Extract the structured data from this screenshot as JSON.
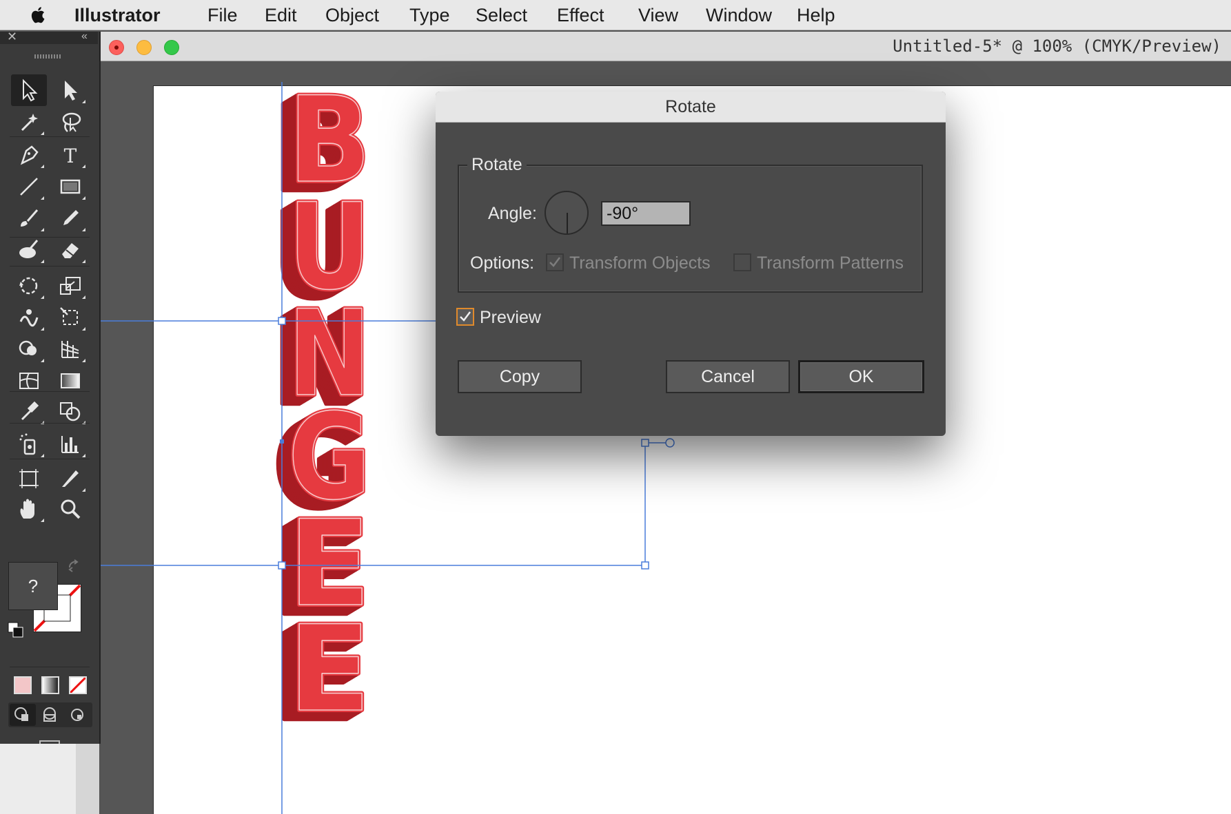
{
  "menubar": {
    "items": [
      "Illustrator",
      "File",
      "Edit",
      "Object",
      "Type",
      "Select",
      "Effect",
      "View",
      "Window",
      "Help"
    ]
  },
  "document": {
    "title": "Untitled-5* @ 100% (CMYK/Preview)"
  },
  "artwork": {
    "letters": [
      "B",
      "U",
      "N",
      "G",
      "E",
      "E"
    ],
    "colors": {
      "face": "#e63a40",
      "extrude": "#a81c23",
      "inline": "#f7c9cb",
      "selection": "#4a7ddb"
    }
  },
  "tools_panel": {
    "fill_unknown_label": "?",
    "tools": [
      "selection-tool",
      "direct-selection-tool",
      "magic-wand-tool",
      "lasso-tool",
      "pen-tool",
      "type-tool",
      "line-tool",
      "rectangle-tool",
      "paintbrush-tool",
      "pencil-tool",
      "blob-brush-tool",
      "eraser-tool",
      "rotate-tool",
      "scale-tool",
      "warp-tool",
      "free-transform-tool",
      "shape-builder-tool",
      "perspective-grid-tool",
      "mesh-tool",
      "gradient-tool",
      "eyedropper-tool",
      "blend-tool",
      "symbol-sprayer-tool",
      "column-graph-tool",
      "artboard-tool",
      "slice-tool",
      "hand-tool",
      "zoom-tool"
    ]
  },
  "dialog": {
    "title": "Rotate",
    "group_label": "Rotate",
    "angle_label": "Angle:",
    "angle_value": "-90°",
    "options_label": "Options:",
    "transform_objects_label": "Transform Objects",
    "transform_objects_checked": true,
    "transform_patterns_label": "Transform Patterns",
    "transform_patterns_checked": false,
    "preview_label": "Preview",
    "preview_checked": true,
    "copy_label": "Copy",
    "cancel_label": "Cancel",
    "ok_label": "OK"
  }
}
